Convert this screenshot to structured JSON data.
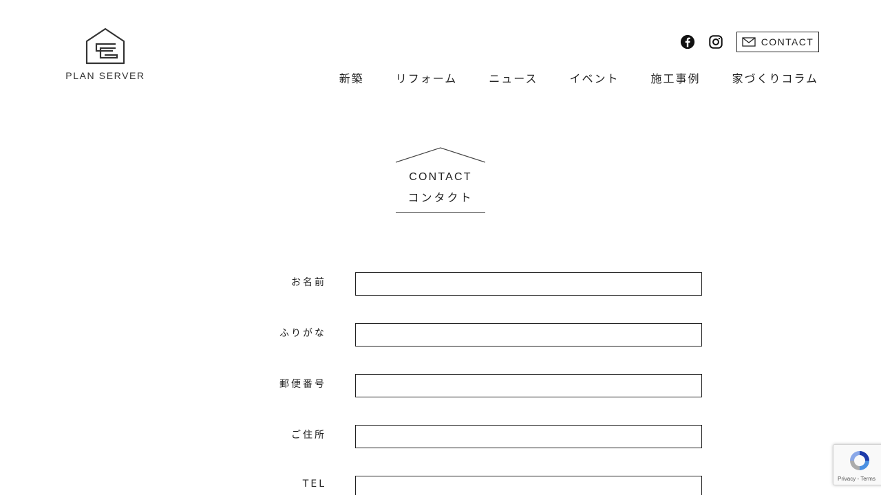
{
  "brand": {
    "logo_text": "PLAN SERVER"
  },
  "header": {
    "social": [
      {
        "name": "facebook-icon"
      },
      {
        "name": "instagram-icon"
      }
    ],
    "contact_label": "CONTACT"
  },
  "nav": {
    "items": [
      {
        "label": "新築"
      },
      {
        "label": "リフォーム"
      },
      {
        "label": "ニュース"
      },
      {
        "label": "イベント"
      },
      {
        "label": "施工事例"
      },
      {
        "label": "家づくりコラム"
      }
    ]
  },
  "page_heading": {
    "en": "CONTACT",
    "ja": "コンタクト"
  },
  "form": {
    "fields": [
      {
        "label": "お名前",
        "value": ""
      },
      {
        "label": "ふりがな",
        "value": ""
      },
      {
        "label": "郵便番号",
        "value": ""
      },
      {
        "label": "ご住所",
        "value": ""
      },
      {
        "label": "TEL",
        "value": ""
      }
    ]
  },
  "recaptcha": {
    "footer": "Privacy - Terms"
  },
  "colors": {
    "text": "#222222",
    "border": "#222222",
    "background": "#ffffff"
  }
}
